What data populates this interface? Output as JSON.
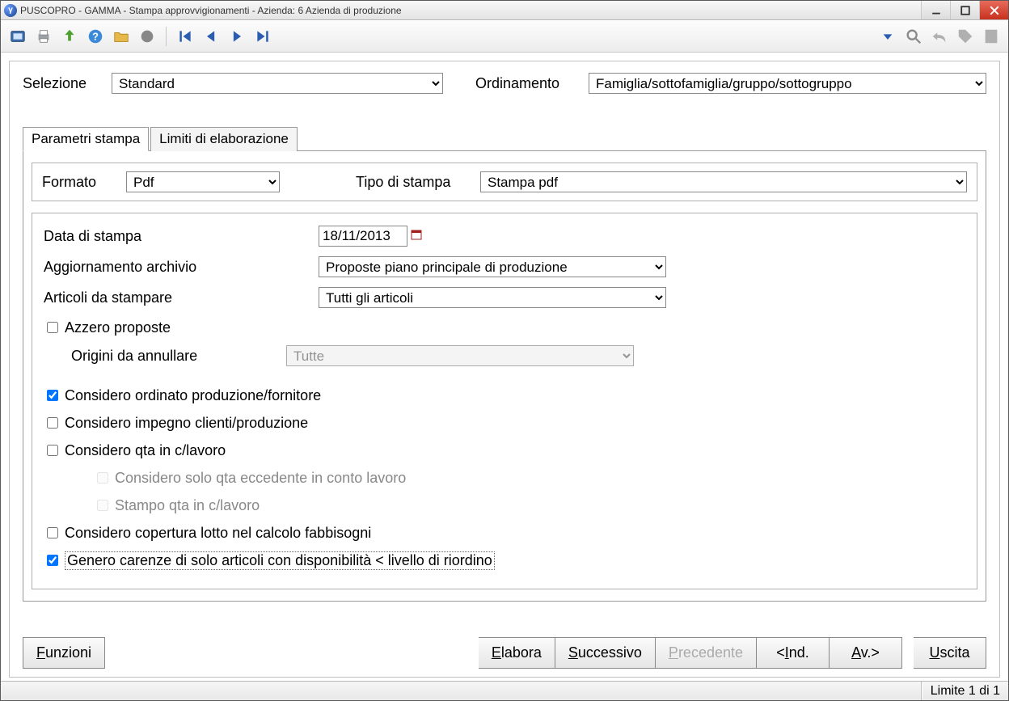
{
  "window": {
    "title": "PUSCOPRO - GAMMA - Stampa approvvigionamenti - Azienda:    6 Azienda di produzione"
  },
  "topform": {
    "selezione_label": "Selezione",
    "selezione_value": "Standard",
    "ordinamento_label": "Ordinamento",
    "ordinamento_value": "Famiglia/sottofamiglia/gruppo/sottogruppo"
  },
  "tabs": {
    "tab1": "Parametri stampa",
    "tab2": "Limiti di elaborazione"
  },
  "format": {
    "formato_label": "Formato",
    "formato_value": "Pdf",
    "tipo_label": "Tipo di stampa",
    "tipo_value": "Stampa pdf"
  },
  "params": {
    "data_label": "Data di stampa",
    "data_value": "18/11/2013",
    "aggiornamento_label": "Aggiornamento archivio",
    "aggiornamento_value": "Proposte piano principale di produzione",
    "articoli_label": "Articoli da stampare",
    "articoli_value": "Tutti gli articoli",
    "azzero_label": "Azzero proposte",
    "origini_label": "Origini da annullare",
    "origini_value": "Tutte",
    "chk1_label": "Considero ordinato produzione/fornitore",
    "chk2_label": "Considero impegno clienti/produzione",
    "chk3_label": "Considero qta in c/lavoro",
    "chk3a_label": "Considero solo qta eccedente in conto lavoro",
    "chk3b_label": "Stampo qta in c/lavoro",
    "chk4_label": "Considero copertura lotto nel calcolo fabbisogni",
    "chk5_label": "Genero carenze di solo articoli con disponibilità < livello di riordino"
  },
  "buttons": {
    "funzioni": "Funzioni",
    "elabora": "Elabora",
    "successivo": "Successivo",
    "precedente": "Precedente",
    "ind": "<Ind.",
    "av": "Av.>",
    "uscita": "Uscita"
  },
  "statusbar": {
    "right": "Limite 1 di 1"
  }
}
